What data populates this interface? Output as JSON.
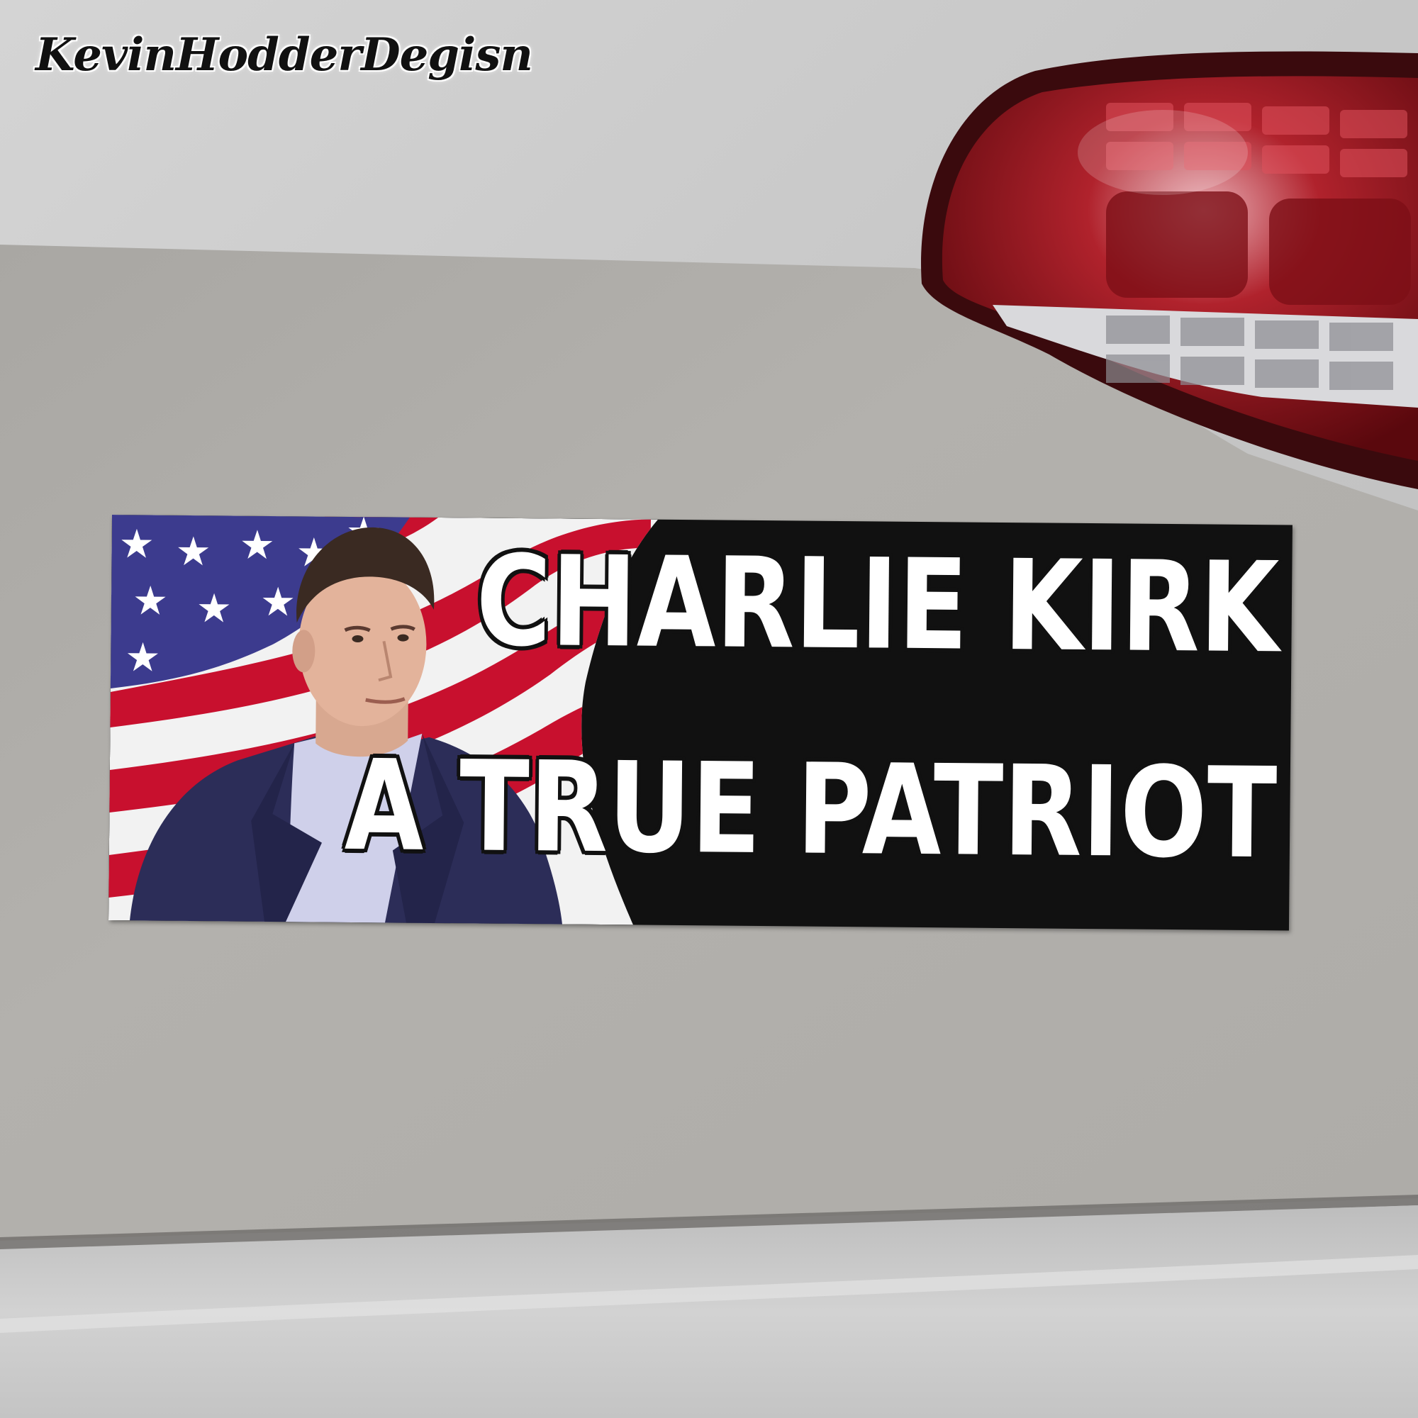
{
  "watermark": {
    "text": "KevinHodderDegisn"
  },
  "sticker": {
    "line1": "CHARLIE KIRK",
    "line2": "A TRUE PATRIOT"
  },
  "colors": {
    "car_paint": "#b9b9b9",
    "sticker_background": "#111111",
    "sticker_text": "#ffffff",
    "flag_red": "#c8102e",
    "flag_blue": "#3c3b8e",
    "taillight_red": "#7a0c12"
  }
}
